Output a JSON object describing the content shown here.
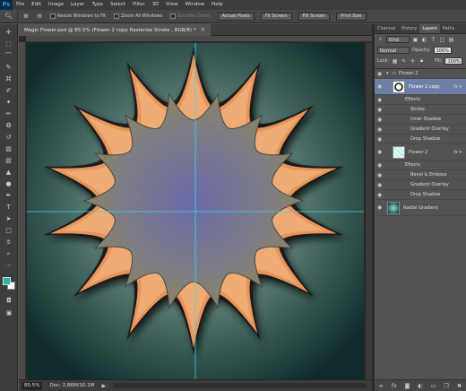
{
  "menubar": {
    "logo": "Ps",
    "items": [
      "File",
      "Edit",
      "Image",
      "Layer",
      "Type",
      "Select",
      "Filter",
      "3D",
      "View",
      "Window",
      "Help"
    ]
  },
  "options": {
    "resize_windows": "Resize Windows to Fit",
    "zoom_all": "Zoom All Windows",
    "scrubby_zoom": "Scrubby Zoom",
    "actual_pixels": "Actual Pixels",
    "fit_screen": "Fit Screen",
    "fill_screen": "Fill Screen",
    "print_size": "Print Size"
  },
  "document": {
    "tab_title": "Magic Flower.psd @ 85.5% (Flower 2  copy     Rasterize Stroke  , RGB/8) *",
    "zoom": "85.5%",
    "doc_size": "Doc: 2.86M/10.1M"
  },
  "colors": {
    "foreground": "#2fb3a8",
    "background": "#ffffff",
    "canvas_bg_center": "#9ec6b8",
    "canvas_bg_edge": "#0f2c2a",
    "petal": "#e8945a",
    "guide": "#38d6f0"
  },
  "panel": {
    "tabs": [
      "Channel",
      "History",
      "Layers",
      "Paths"
    ],
    "active_tab": "Layers",
    "kind": "Kind",
    "blend_mode": "Normal",
    "opacity_label": "Opacity:",
    "opacity_value": "100%",
    "lock_label": "Lock:",
    "fill_label": "Fill:",
    "fill_value": "100%",
    "group_name": "Flower 2",
    "layers": [
      {
        "name": "Flower 2  copy",
        "selected": true,
        "effects_label": "Effects",
        "effects": [
          "Stroke",
          "Inner Shadow",
          "Gradient Overlay",
          "Drop Shadow"
        ]
      },
      {
        "name": "Flower 2",
        "selected": false,
        "effects_label": "Effects",
        "effects": [
          "Bevel & Emboss",
          "Gradient Overlay",
          "Drop Shadow"
        ]
      }
    ],
    "bottom_layer": "Radial Gradient"
  }
}
